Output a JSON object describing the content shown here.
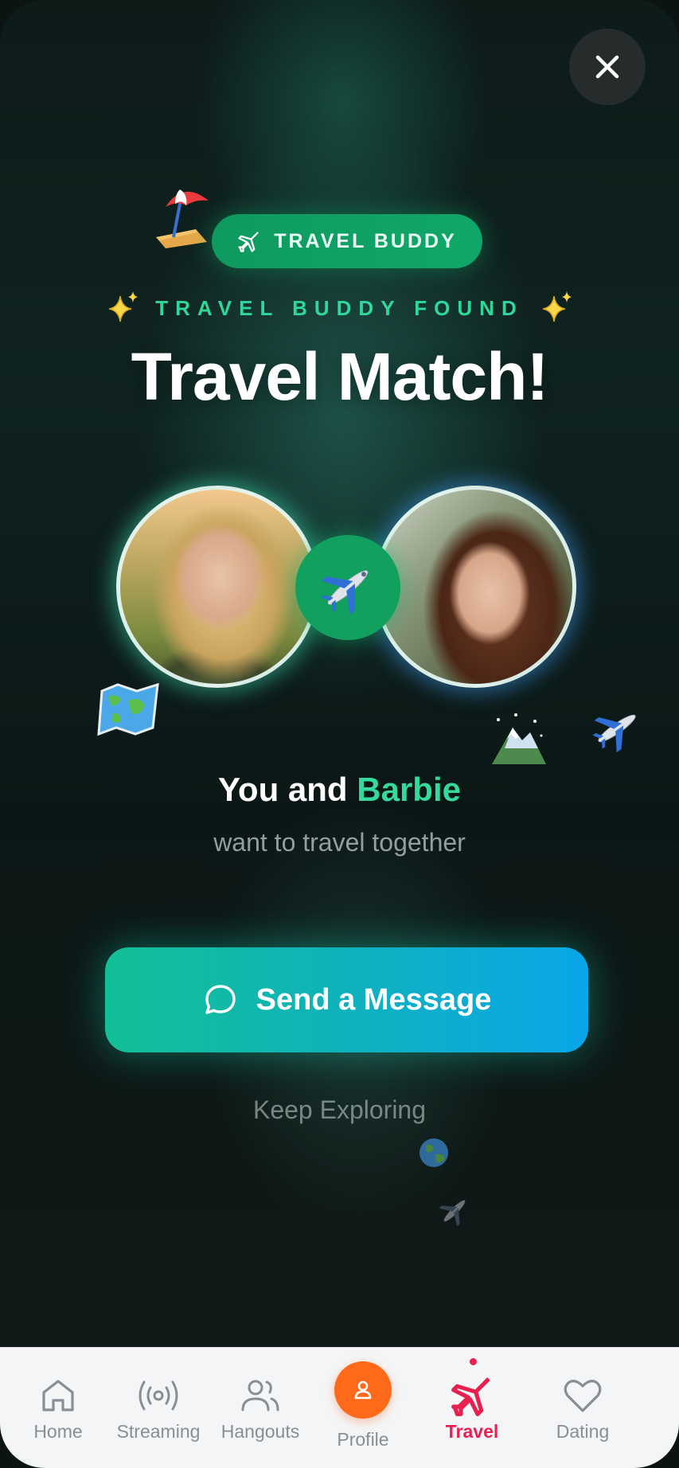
{
  "badge": {
    "label": "TRAVEL BUDDY"
  },
  "eyebrow": {
    "label": "TRAVEL BUDDY FOUND"
  },
  "headline": "Travel Match!",
  "match": {
    "prefix": "You and",
    "name": "Barbie"
  },
  "subtitle": "want to travel together",
  "actions": {
    "primary": "Send a Message",
    "secondary": "Keep Exploring"
  },
  "tabbar": {
    "items": [
      {
        "label": "Home",
        "icon": "home-icon"
      },
      {
        "label": "Streaming",
        "icon": "broadcast-icon"
      },
      {
        "label": "Hangouts",
        "icon": "users-icon"
      },
      {
        "label": "Profile",
        "icon": "user-icon"
      },
      {
        "label": "Travel",
        "icon": "plane-icon"
      },
      {
        "label": "Dating",
        "icon": "heart-icon"
      }
    ],
    "active": "Travel"
  },
  "colors": {
    "accent_green": "#35d99b",
    "cta_start": "#13bf96",
    "cta_end": "#0aa6ea",
    "travel_active": "#e8204f",
    "profile_orange": "#ff6a1a"
  }
}
